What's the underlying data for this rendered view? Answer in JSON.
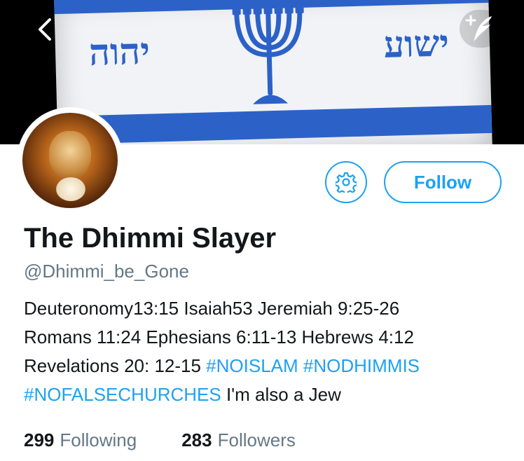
{
  "banner": {
    "hebrew_left": "יהוה",
    "hebrew_right": "ישוע"
  },
  "profile": {
    "name": "The Dhimmi Slayer",
    "handle": "@Dhimmi_be_Gone",
    "follow_label": "Follow",
    "bio": {
      "line1": "Deuteronomy13:15 Isaiah53 Jeremiah 9:25-26",
      "line2": "Romans 11:24 Ephesians 6:11-13 Hebrews 4:12",
      "line3_text": "Revelations 20: 12-15 ",
      "hashtag1": "#NOISLAM",
      "hashtag2": "#NODHIMMIS",
      "hashtag3": "#NOFALSECHURCHES",
      "tail": " I'm also a Jew"
    }
  },
  "stats": {
    "following_count": "299",
    "following_label": "Following",
    "followers_count": "283",
    "followers_label": "Followers"
  },
  "icons": {
    "back": "chevron-left-icon",
    "compose": "quill-plus-icon",
    "settings": "gear-icon"
  },
  "colors": {
    "accent": "#1da1f2",
    "secondary_text": "#657786",
    "flag_blue": "#2c62c8"
  }
}
